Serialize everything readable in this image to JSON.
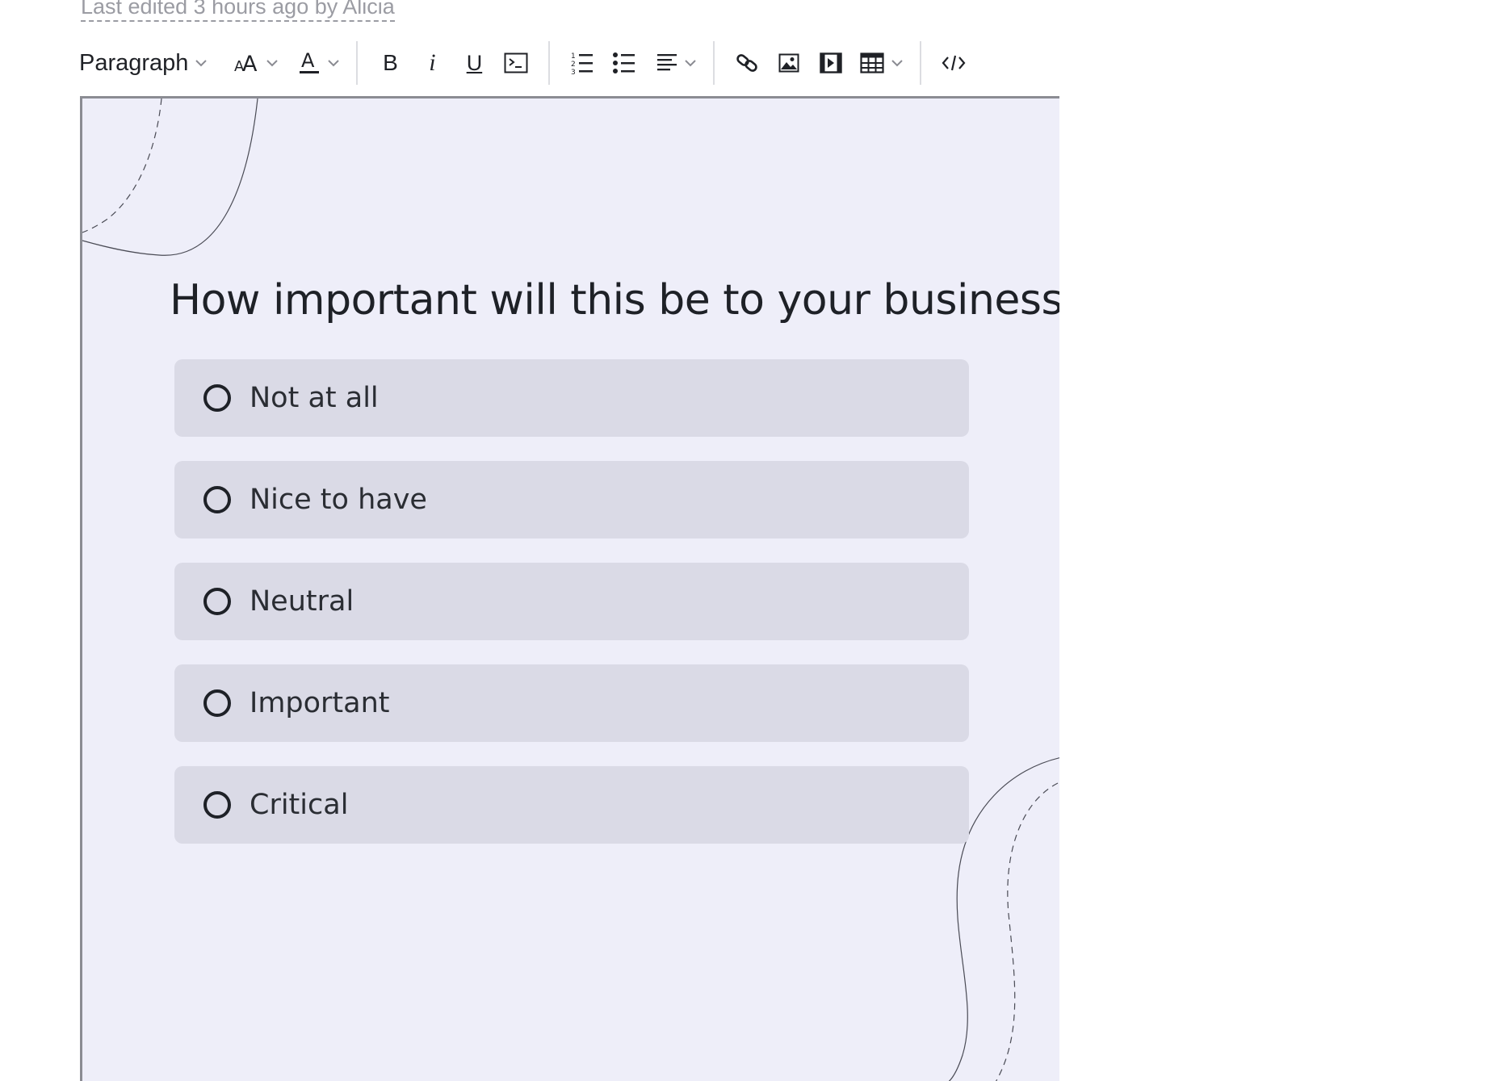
{
  "meta": {
    "last_edited": "Last edited 3 hours ago by Alicia"
  },
  "toolbar": {
    "paragraph_label": "Paragraph",
    "bold_label": "B",
    "italic_label": "i",
    "underline_label": "U",
    "font_size_label": "AA",
    "text_color_label": "A",
    "icons": [
      "font-size-icon",
      "text-color-icon",
      "bold-icon",
      "italic-icon",
      "underline-icon",
      "code-block-icon",
      "numbered-list-icon",
      "bullet-list-icon",
      "align-icon",
      "link-icon",
      "image-icon",
      "video-icon",
      "table-icon",
      "source-code-icon"
    ]
  },
  "form": {
    "question": "How important will this be to your business?",
    "options": [
      {
        "label": "Not at all"
      },
      {
        "label": "Nice to have"
      },
      {
        "label": "Neutral"
      },
      {
        "label": "Important"
      },
      {
        "label": "Critical"
      }
    ]
  },
  "colors": {
    "canvas_bg": "#eeeef9",
    "option_bg": "#dadae6",
    "text": "#1e2127",
    "muted": "#9b9ca3"
  }
}
